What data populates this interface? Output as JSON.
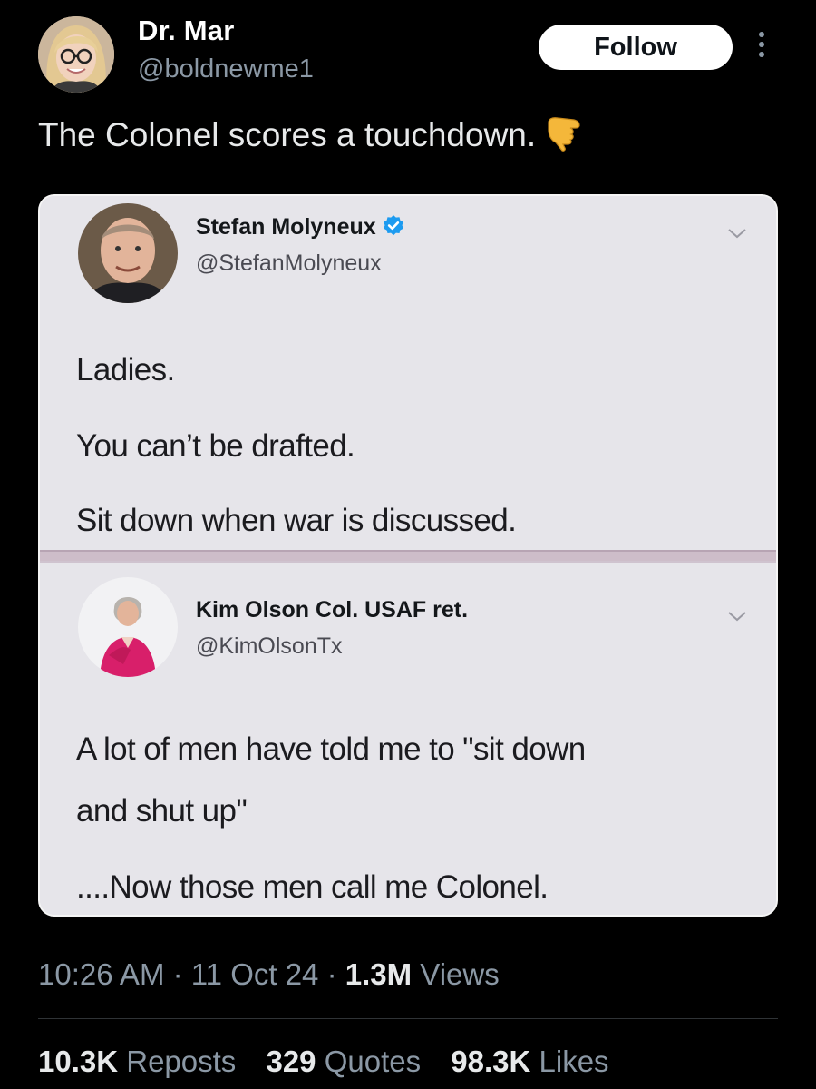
{
  "author": {
    "name": "Dr. Mar",
    "handle": "@boldnewme1",
    "follow_label": "Follow"
  },
  "tweet": {
    "text": "The Colonel scores a touchdown.",
    "emoji": "pointing-down-hand-icon"
  },
  "embedded": {
    "first": {
      "name": "Stefan Molyneux",
      "handle": "@StefanMolyneux",
      "verified": true,
      "lines": [
        "Ladies.",
        "You can’t be drafted.",
        "Sit down when war is discussed."
      ]
    },
    "second": {
      "name": "Kim Olson Col. USAF ret.",
      "handle": "@KimOlsonTx",
      "lines": [
        "A lot of men have told me to \"sit down",
        "and shut up\"",
        "....Now those men call me Colonel."
      ]
    }
  },
  "meta": {
    "time": "10:26 AM",
    "sep1": " · ",
    "date": "11 Oct 24",
    "sep2": " · ",
    "views_count": "1.3M",
    "views_label": " Views"
  },
  "stats": {
    "reposts_count": "10.3K",
    "reposts_label": " Reposts",
    "quotes_count": "329",
    "quotes_label": " Quotes",
    "likes_count": "98.3K",
    "likes_label": " Likes"
  },
  "colors": {
    "background": "#000000",
    "text": "#e7e9ea",
    "muted": "#8b98a5",
    "verified": "#1d9bf0"
  }
}
